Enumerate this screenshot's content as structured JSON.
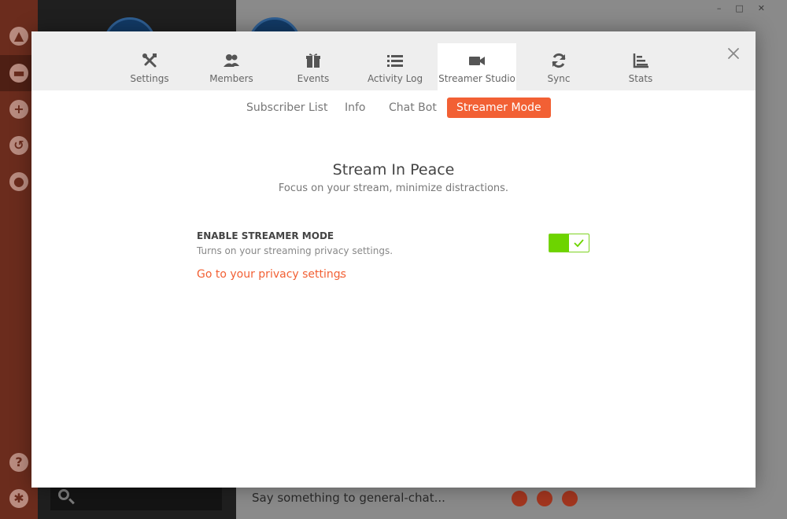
{
  "modal": {
    "tabs": [
      {
        "label": "Settings",
        "icon": "tools-icon"
      },
      {
        "label": "Members",
        "icon": "members-icon"
      },
      {
        "label": "Events",
        "icon": "gift-icon"
      },
      {
        "label": "Activity Log",
        "icon": "list-icon"
      },
      {
        "label": "Streamer Studio",
        "icon": "video-camera-icon",
        "active": true
      },
      {
        "label": "Sync",
        "icon": "sync-icon"
      },
      {
        "label": "Stats",
        "icon": "stats-icon"
      }
    ],
    "sub_tabs": [
      {
        "label": "Subscriber List"
      },
      {
        "label": "Info"
      },
      {
        "label": "Chat Bot"
      },
      {
        "label": "Streamer Mode",
        "active": true
      }
    ],
    "hero_title": "Stream In Peace",
    "hero_subtitle": "Focus on your stream, minimize distractions.",
    "setting": {
      "label": "ENABLE STREAMER MODE",
      "description": "Turns on your streaming privacy settings.",
      "enabled": true
    },
    "privacy_link": "Go to your privacy settings",
    "privacy_period": "."
  },
  "background": {
    "chat_placeholder": "Say something to general-chat..."
  },
  "colors": {
    "accent": "#f26034",
    "toggle_on": "#6dd400",
    "sidebar": "#6b2c1d"
  }
}
